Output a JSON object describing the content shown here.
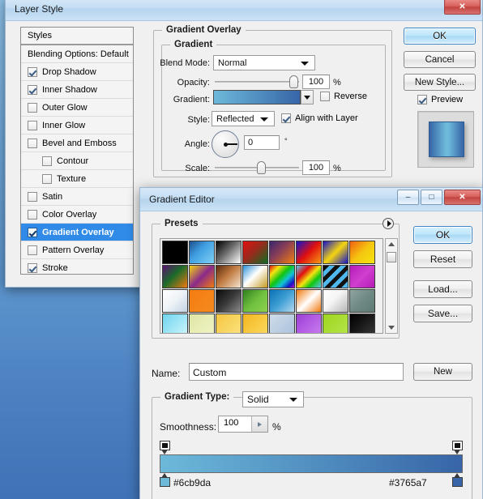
{
  "desktop": {
    "bg_top": "#8fc2e8",
    "bg_bottom": "#3f72b6"
  },
  "layer_style": {
    "title": "Layer Style",
    "window_buttons": {
      "minimize": "–",
      "maximize": "□",
      "close": "✕"
    },
    "styles_panel": {
      "header": "Styles",
      "items": [
        {
          "label": "Blending Options: Default",
          "checkbox": false,
          "checked": false,
          "selected": false,
          "indent": false
        },
        {
          "label": "Drop Shadow",
          "checkbox": true,
          "checked": true,
          "selected": false,
          "indent": false
        },
        {
          "label": "Inner Shadow",
          "checkbox": true,
          "checked": true,
          "selected": false,
          "indent": false
        },
        {
          "label": "Outer Glow",
          "checkbox": true,
          "checked": false,
          "selected": false,
          "indent": false
        },
        {
          "label": "Inner Glow",
          "checkbox": true,
          "checked": false,
          "selected": false,
          "indent": false
        },
        {
          "label": "Bevel and Emboss",
          "checkbox": true,
          "checked": false,
          "selected": false,
          "indent": false
        },
        {
          "label": "Contour",
          "checkbox": true,
          "checked": false,
          "selected": false,
          "indent": true
        },
        {
          "label": "Texture",
          "checkbox": true,
          "checked": false,
          "selected": false,
          "indent": true
        },
        {
          "label": "Satin",
          "checkbox": true,
          "checked": false,
          "selected": false,
          "indent": false
        },
        {
          "label": "Color Overlay",
          "checkbox": true,
          "checked": false,
          "selected": false,
          "indent": false
        },
        {
          "label": "Gradient Overlay",
          "checkbox": true,
          "checked": true,
          "selected": true,
          "indent": false
        },
        {
          "label": "Pattern Overlay",
          "checkbox": true,
          "checked": false,
          "selected": false,
          "indent": false
        },
        {
          "label": "Stroke",
          "checkbox": true,
          "checked": true,
          "selected": false,
          "indent": false
        }
      ]
    },
    "panel": {
      "group_title": "Gradient Overlay",
      "subgroup_title": "Gradient",
      "blend_mode_label": "Blend Mode:",
      "blend_mode_value": "Normal",
      "opacity_label": "Opacity:",
      "opacity_value": "100",
      "opacity_unit": "%",
      "gradient_label": "Gradient:",
      "gradient_start": "#6cb9da",
      "gradient_end": "#3765a7",
      "reverse_label": "Reverse",
      "reverse_checked": false,
      "style_label": "Style:",
      "style_value": "Reflected",
      "align_label": "Align with Layer",
      "align_checked": true,
      "angle_label": "Angle:",
      "angle_value": "0",
      "angle_unit": "°",
      "scale_label": "Scale:",
      "scale_value": "100",
      "scale_unit": "%"
    },
    "buttons": {
      "ok": "OK",
      "cancel": "Cancel",
      "new_style": "New Style...",
      "preview_label": "Preview",
      "preview_checked": true
    }
  },
  "gradient_editor": {
    "title": "Gradient Editor",
    "window_buttons": {
      "minimize": "–",
      "maximize": "□",
      "close": "✕"
    },
    "presets_label": "Presets",
    "presets": [
      {
        "name": "black-white-solid",
        "css": "linear-gradient(135deg,#000 0%,#000 100%)"
      },
      {
        "name": "blue-checker",
        "css": "linear-gradient(135deg,#1b4f8f 0%,#3f9de0 40%,#7fd2f5 100%)"
      },
      {
        "name": "black-to-white",
        "css": "linear-gradient(135deg,#000 0%,#6a6a6a 45%,#fff 100%)"
      },
      {
        "name": "red-green",
        "css": "linear-gradient(135deg,#e11010 0%,#9a2a1c 45%,#0f6b21 100%)"
      },
      {
        "name": "purple-orange",
        "css": "linear-gradient(135deg,#3a2470 0%,#8a3f55 45%,#f07f10 100%)"
      },
      {
        "name": "blue-red-orange",
        "css": "linear-gradient(135deg,#1414c8 0%,#e01010 50%,#f59a10 100%)"
      },
      {
        "name": "blue-yellow-blue",
        "css": "linear-gradient(135deg,#1414c8 0%,#f5d510 50%,#1414c8 100%)"
      },
      {
        "name": "orange-yellow",
        "css": "linear-gradient(135deg,#f06010 0%,#f5c510 50%,#f5e510 100%)"
      },
      {
        "name": "violet-green-orange",
        "css": "linear-gradient(135deg,#5a1070 0%,#1a6b2a 45%,#f07a10 100%)"
      },
      {
        "name": "yellow-violet-orange",
        "css": "linear-gradient(135deg,#f5d510 0%,#8a2a8a 50%,#f07a10 100%)"
      },
      {
        "name": "copper",
        "css": "linear-gradient(135deg,#5a2a10 0%,#c07a40 45%,#f5e5d0 100%)"
      },
      {
        "name": "blue-white-gold",
        "css": "linear-gradient(135deg,#2a8fd5 0%,#ffffff 45%,#c59a20 100%)"
      },
      {
        "name": "spectrum",
        "css": "linear-gradient(135deg,#e01010 0%,#f5e510 22%,#10c510 46%,#10c5d5 66%,#1414c8 86%,#c510c5 100%)"
      },
      {
        "name": "transparent-rainbow",
        "css": "linear-gradient(135deg,#5fc5f0 0%,#e01010 30%,#f5e510 52%,#10c510 72%,#5fc5f0 100%)"
      },
      {
        "name": "blue-black-stripes",
        "css": "repeating-linear-gradient(135deg,#111 0 5px,#4fb8ef 5px 10px)"
      },
      {
        "name": "magenta",
        "css": "linear-gradient(135deg,#b51bb5 0%,#cf3fcf 50%,#b51bb5 100%)"
      },
      {
        "name": "white-blue-fade",
        "css": "linear-gradient(135deg,#ffffff 0%,#f0f4f8 45%,#c3d4e5 100%)"
      },
      {
        "name": "orange-solid",
        "css": "linear-gradient(135deg,#f57c10 0%,#f58a20 100%)"
      },
      {
        "name": "black-gray",
        "css": "linear-gradient(135deg,#0a0a0a 0%,#3a3a3a 50%,#8a8a8a 100%)"
      },
      {
        "name": "green-noise",
        "css": "linear-gradient(135deg,#2f7f1f 0%,#6fc03f 50%,#8fd04f 100%)"
      },
      {
        "name": "blue-lightblue",
        "css": "linear-gradient(135deg,#0a72b5 0%,#3f9fd5 50%,#b5d9ef 100%)"
      },
      {
        "name": "orange-white-orange",
        "css": "linear-gradient(135deg,#f07a10 0%,#ffffff 50%,#f07a10 100%)"
      },
      {
        "name": "white-gray",
        "css": "linear-gradient(135deg,#ffffff 0%,#f4f4f4 45%,#b5b5b5 100%)"
      },
      {
        "name": "slate-gray-green",
        "css": "linear-gradient(135deg,#8fa5a0 0%,#6f8a85 50%,#5f7a75 100%)"
      },
      {
        "name": "cyan-light",
        "css": "linear-gradient(135deg,#6fd5ef 0%,#9fe5f5 50%,#cff5fb 100%)"
      },
      {
        "name": "pale-yellow",
        "css": "linear-gradient(135deg,#dfe5a5 0%,#e8eeb5 50%,#eff3c5 100%)"
      },
      {
        "name": "amber",
        "css": "linear-gradient(135deg,#f5c540 0%,#f8d560 50%,#fbe280 100%)"
      },
      {
        "name": "gold",
        "css": "linear-gradient(135deg,#f5b520 0%,#f8c940 50%,#fbd960 100%)"
      },
      {
        "name": "pale-blue",
        "css": "linear-gradient(135deg,#cfdceb 0%,#bccfe3 50%,#a9c2db 100%)"
      },
      {
        "name": "purple",
        "css": "linear-gradient(135deg,#9a3fd5 0%,#b55fe5 50%,#c97fef 100%)"
      },
      {
        "name": "lime",
        "css": "linear-gradient(135deg,#9fd520 0%,#aade35 50%,#b5e54a 100%)"
      },
      {
        "name": "black-dark",
        "css": "linear-gradient(135deg,#000000 0%,#1a1a1a 50%,#3a3a3a 100%)"
      }
    ],
    "name_label": "Name:",
    "name_value": "Custom",
    "new_button": "New",
    "gradient_type_label": "Gradient Type:",
    "gradient_type_value": "Solid",
    "smoothness_label": "Smoothness:",
    "smoothness_value": "100",
    "smoothness_unit": "%",
    "stops": {
      "left_color": "#6cb9da",
      "right_color": "#3765a7"
    },
    "buttons": {
      "ok": "OK",
      "reset": "Reset",
      "load": "Load...",
      "save": "Save..."
    }
  }
}
